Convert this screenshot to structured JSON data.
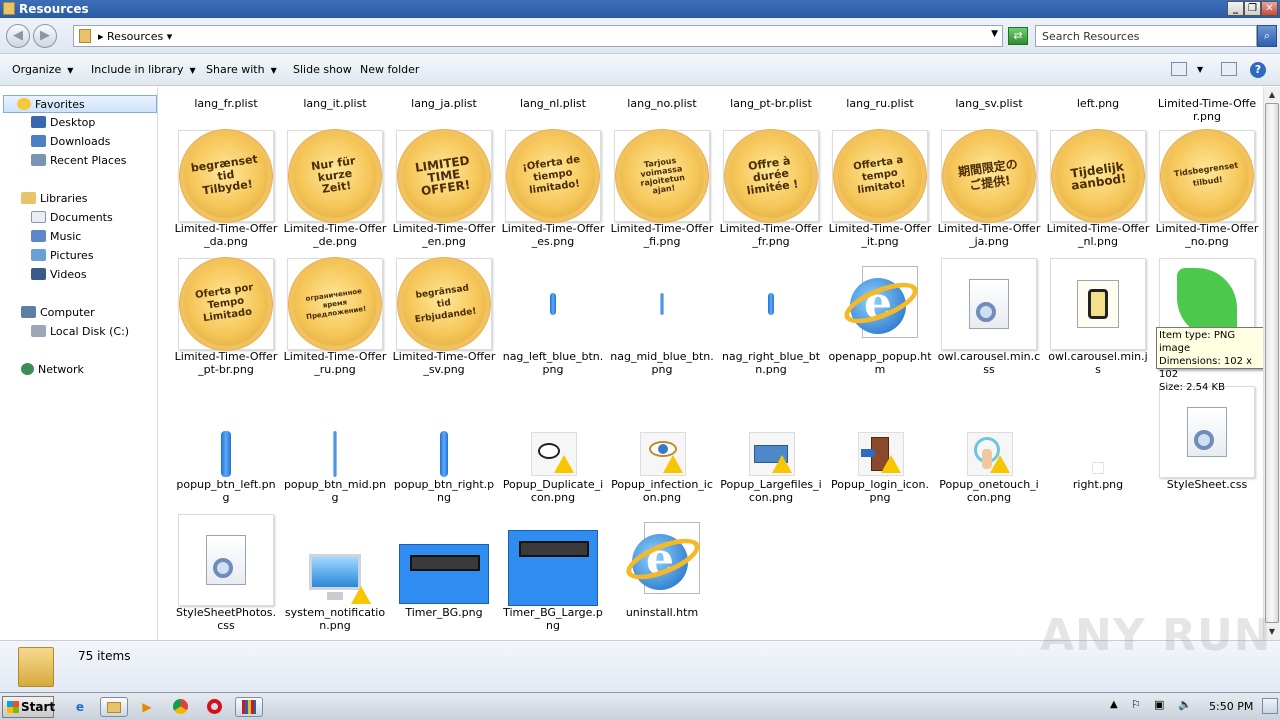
{
  "window": {
    "title": "Resources"
  },
  "address": {
    "crumb": "Resources",
    "search_placeholder": "Search Resources"
  },
  "toolbar": {
    "organize": "Organize",
    "include": "Include in library",
    "share": "Share with",
    "slideshow": "Slide show",
    "newfolder": "New folder"
  },
  "nav": {
    "favorites": "Favorites",
    "desktop": "Desktop",
    "downloads": "Downloads",
    "recent": "Recent Places",
    "libraries": "Libraries",
    "documents": "Documents",
    "music": "Music",
    "pictures": "Pictures",
    "videos": "Videos",
    "computer": "Computer",
    "localdisk": "Local Disk (C:)",
    "network": "Network"
  },
  "files": {
    "row0": [
      "lang_fr.plist",
      "lang_it.plist",
      "lang_ja.plist",
      "lang_nl.plist",
      "lang_no.plist",
      "lang_pt-br.plist",
      "lang_ru.plist",
      "lang_sv.plist",
      "left.png",
      "Limited-Time-Offer.png"
    ],
    "row1": [
      "Limited-Time-Offer_da.png",
      "Limited-Time-Offer_de.png",
      "Limited-Time-Offer_en.png",
      "Limited-Time-Offer_es.png",
      "Limited-Time-Offer_fi.png",
      "Limited-Time-Offer_fr.png",
      "Limited-Time-Offer_it.png",
      "Limited-Time-Offer_ja.png",
      "Limited-Time-Offer_nl.png",
      "Limited-Time-Offer_no.png"
    ],
    "row2": [
      "Limited-Time-Offer_pt-br.png",
      "Limited-Time-Offer_ru.png",
      "Limited-Time-Offer_sv.png",
      "nag_left_blue_btn.png",
      "nag_mid_blue_btn.png",
      "nag_right_blue_btn.png",
      "openapp_popup.htm",
      "owl.carousel.min.css",
      "owl.carousel.min.js",
      ""
    ],
    "row3": [
      "popup_btn_left.png",
      "popup_btn_mid.png",
      "popup_btn_right.png",
      "Popup_Duplicate_icon.png",
      "Popup_infection_icon.png",
      "Popup_Largefiles_icon.png",
      "Popup_login_icon.png",
      "Popup_onetouch_icon.png",
      "right.png",
      "StyleSheet.css"
    ],
    "row4": [
      "StyleSheetPhotos.css",
      "system_notification.png",
      "Timer_BG.png",
      "Timer_BG_Large.png",
      "uninstall.htm"
    ]
  },
  "badges": {
    "da": "begrænset tid Tilbyde!",
    "de": "Nur für kurze Zeit!",
    "en": "LIMITED TIME OFFER!",
    "es": "¡Oferta de tiempo limitado!",
    "fi": "Tarjous voimassa rajoitetun ajan!",
    "fr": "Offre à durée limitée !",
    "it": "Offerta a tempo limitato!",
    "ja": "期間限定のご提供!",
    "nl": "Tijdelijk aanbod!",
    "no": "Tidsbegrenset tilbud!",
    "ptbr": "Oferta por Tempo Limitado",
    "ru": "ограниченное время Предложение!",
    "sv": "begränsad tid Erbjudande!"
  },
  "tooltip": {
    "line1": "Item type: PNG image",
    "line2": "Dimensions: 102 x 102",
    "line3": "Size: 2.54 KB"
  },
  "details": {
    "count": "75 items"
  },
  "taskbar": {
    "start": "Start",
    "clock": "5:50 PM"
  },
  "watermark": "ANY RUN"
}
